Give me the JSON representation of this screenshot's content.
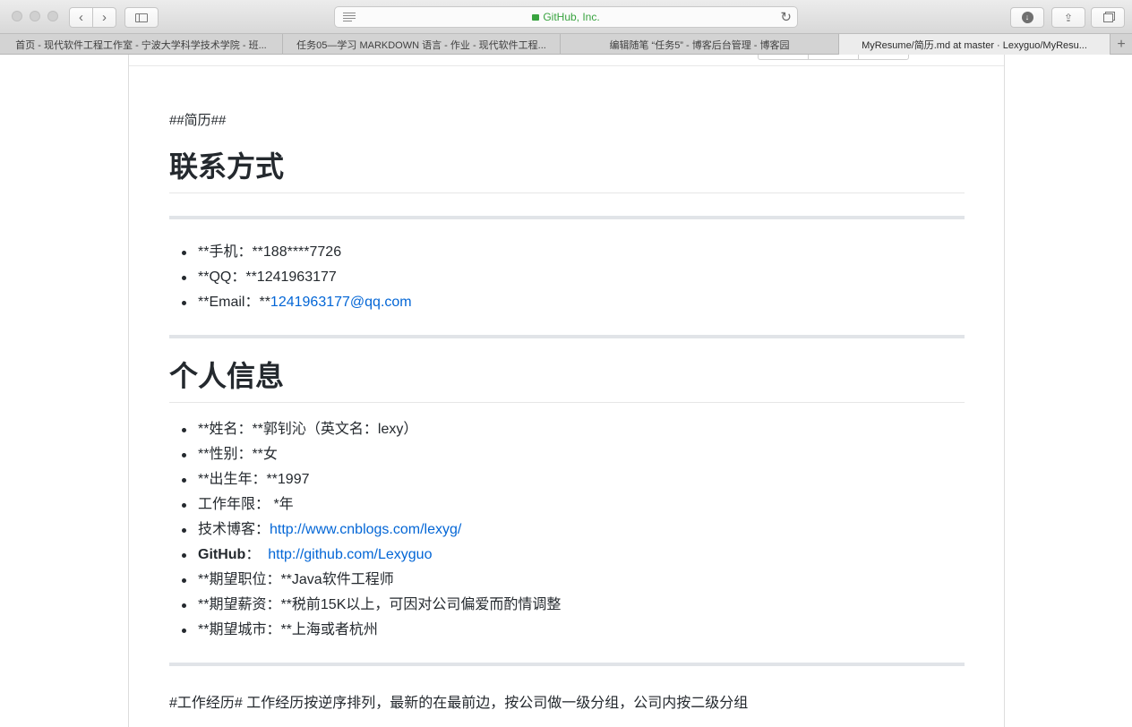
{
  "browser": {
    "site_label": "GitHub, Inc.",
    "tabs": [
      "首页 - 现代软件工程工作室 - 宁波大学科学技术学院 - 班...",
      "任务05—学习 MARKDOWN 语言 - 作业 - 现代软件工程...",
      "编辑随笔 “任务5” - 博客后台管理 - 博客园",
      "MyResume/简历.md at master · Lexyguo/MyResu..."
    ]
  },
  "doc": {
    "intro": "##简历##",
    "contact": {
      "heading": "联系方式",
      "phone": "**手机：**188****7726",
      "qq": "**QQ：**1241963177",
      "email_prefix": "**Email：**",
      "email_link": "1241963177@qq.com"
    },
    "personal": {
      "heading": "个人信息",
      "name": "**姓名：**郭钊沁（英文名：lexy）",
      "gender": "**性别：**女",
      "birth": "**出生年：**1997",
      "years": "工作年限： *年",
      "blog_prefix": "技术博客：",
      "blog_link": "http://www.cnblogs.com/lexyg/",
      "github_label": "GitHub",
      "github_sep": "：",
      "github_link": "http://github.com/Lexyguo",
      "position": "**期望职位：**Java软件工程师",
      "salary": "**期望薪资：**税前15K以上，可因对公司偏爱而酌情调整",
      "city": "**期望城市：**上海或者杭州"
    },
    "work": "#工作经历# 工作经历按逆序排列，最新的在最前边，按公司做一级分组，公司内按二级分组"
  }
}
